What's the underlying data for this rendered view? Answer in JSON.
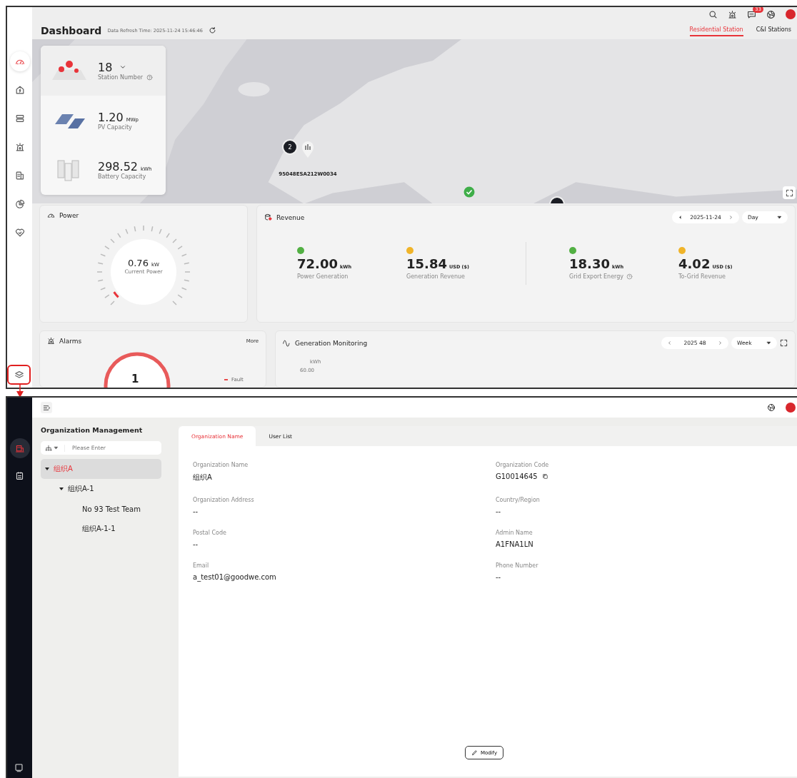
{
  "dashboard": {
    "nav_items": [
      {
        "kind": "gauge",
        "selected": true
      },
      {
        "kind": "home",
        "selected": false
      },
      {
        "kind": "devices",
        "selected": false
      },
      {
        "kind": "alarm",
        "selected": false
      },
      {
        "kind": "report",
        "selected": false
      },
      {
        "kind": "pie",
        "selected": false
      },
      {
        "kind": "heart",
        "selected": false
      }
    ],
    "highlighted_nav": {
      "kind": "layers"
    },
    "message_count": "33",
    "title": "Dashboard",
    "refresh_time": "Data Refresh Time: 2025-11-24 15:46:46",
    "station_tabs": [
      {
        "label": "Residential Station",
        "selected": true
      },
      {
        "label": "C&I Stations",
        "selected": false
      }
    ],
    "summary": {
      "station_count": "18",
      "station_label": "Station Number",
      "pv_value": "1.20",
      "pv_unit": "MWp",
      "pv_label": "PV Capacity",
      "battery_value": "298.52",
      "battery_unit": "kWh",
      "battery_label": "Battery Capacity"
    },
    "map_markers": [
      {
        "kind": "cluster",
        "label": "2"
      },
      {
        "kind": "station",
        "label": "95048ESA212W0034"
      },
      {
        "kind": "ok"
      },
      {
        "kind": "cluster"
      }
    ],
    "power": {
      "title": "Power",
      "value": "0.76",
      "unit": "kW",
      "label": "Current Power",
      "level": 0.04
    },
    "revenue": {
      "title": "Revenue",
      "date": "2025-11-24",
      "period": "Day",
      "metrics": [
        {
          "value": "72.00",
          "unit": "kWh",
          "label": "Power Generation",
          "color": "#52b043",
          "help": false
        },
        {
          "value": "15.84",
          "unit": "USD ($)",
          "label": "Generation Revenue",
          "color": "#f0b429",
          "help": false
        },
        {
          "value": "18.30",
          "unit": "kWh",
          "label": "Grid Export Energy",
          "color": "#52b043",
          "help": true
        },
        {
          "value": "4.02",
          "unit": "USD ($)",
          "label": "To-Grid Revenue",
          "color": "#f0b429",
          "help": false
        }
      ]
    },
    "alarms": {
      "title": "Alarms",
      "more": "More",
      "count": "1",
      "legend": [
        {
          "label": "Fault",
          "color": "#e84a4a"
        }
      ]
    },
    "generation": {
      "title": "Generation Monitoring",
      "period_value": "2025 48",
      "period": "Week",
      "y_unit": "kWh",
      "y_tick": "60.00"
    }
  },
  "org": {
    "title": "Organization Management",
    "search_placeholder": "Please Enter",
    "tree": [
      {
        "label": "组织A",
        "selected": true,
        "expanded": true,
        "children": [
          {
            "label": "组织A-1",
            "selected": false,
            "expanded": true,
            "children": [
              {
                "label": "No 93 Test Team",
                "selected": false
              },
              {
                "label": "组织A-1-1",
                "selected": false
              }
            ]
          }
        ]
      }
    ],
    "tabs": [
      {
        "label": "Organization Name",
        "selected": true
      },
      {
        "label": "User List",
        "selected": false
      }
    ],
    "fields": [
      {
        "label": "Organization Name",
        "value": "组织A",
        "copy": false
      },
      {
        "label": "Organization Code",
        "value": "G10014645",
        "copy": true
      },
      {
        "label": "Organization Address",
        "value": "--",
        "copy": false
      },
      {
        "label": "Country/Region",
        "value": "--",
        "copy": false
      },
      {
        "label": "Postal Code",
        "value": "--",
        "copy": false
      },
      {
        "label": "Admin Name",
        "value": "A1FNA1LN",
        "copy": false
      },
      {
        "label": "Email",
        "value": "a_test01@goodwe.com",
        "copy": false
      },
      {
        "label": "Phone Number",
        "value": "--",
        "copy": false
      }
    ],
    "modify_button": "Modify"
  }
}
